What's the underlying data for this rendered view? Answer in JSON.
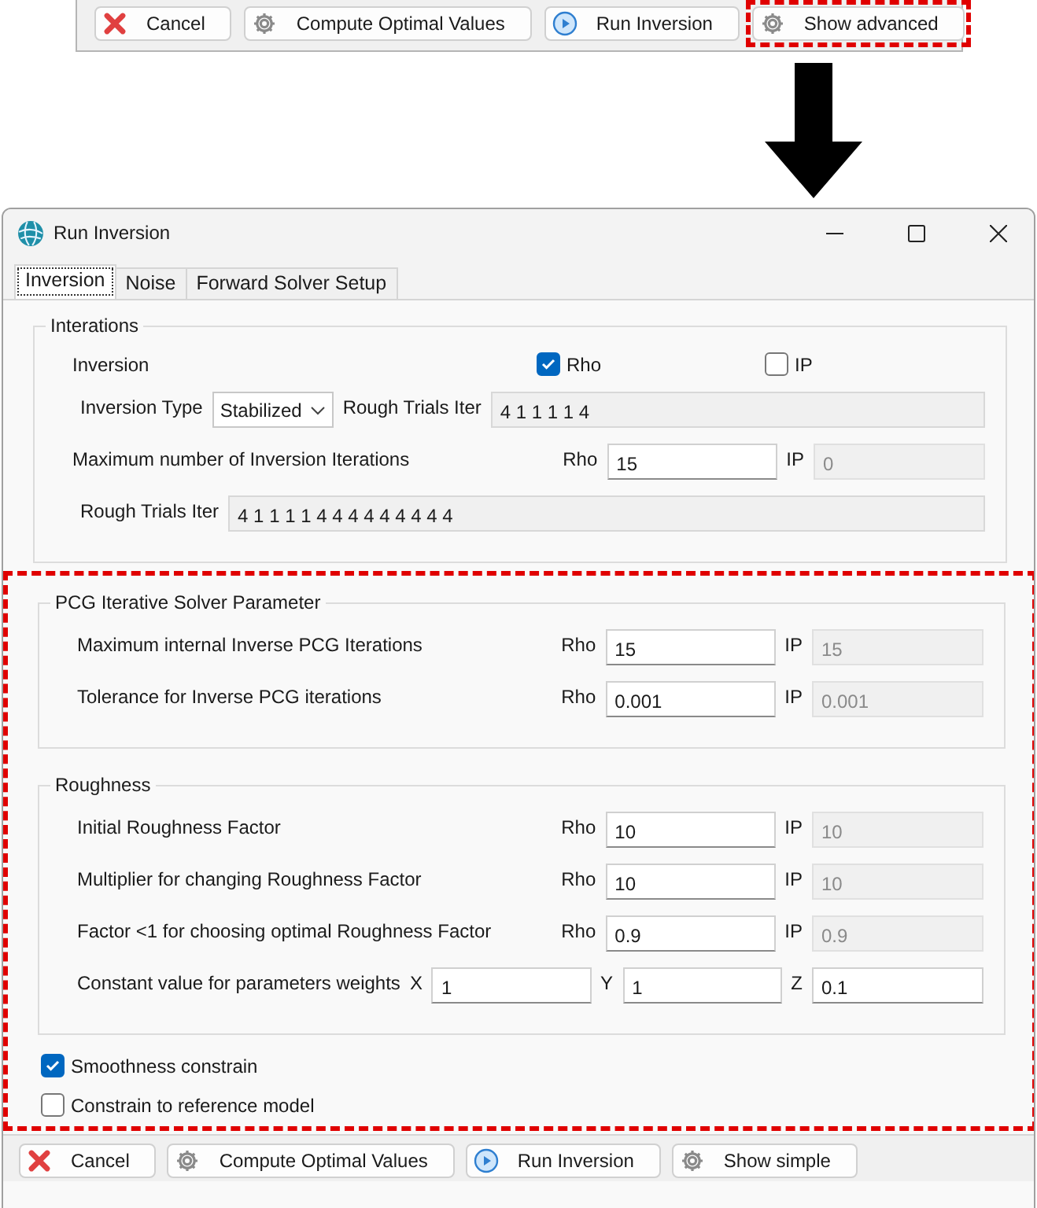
{
  "top_toolbar": {
    "buttons": [
      {
        "label": "Cancel",
        "highlighted": false
      },
      {
        "label": "Compute Optimal Values",
        "highlighted": false
      },
      {
        "label": "Run Inversion",
        "highlighted": false
      },
      {
        "label": "Show advanced",
        "highlighted": true
      }
    ]
  },
  "window": {
    "title": "Run Inversion"
  },
  "tabs": [
    {
      "label": "Inversion",
      "selected": true
    },
    {
      "label": "Noise",
      "selected": false
    },
    {
      "label": "Forward Solver Setup",
      "selected": false
    }
  ],
  "interations": {
    "title": "Interations",
    "inversion_label": "Inversion",
    "checkboxes": [
      {
        "label": "Rho",
        "checked": true
      },
      {
        "label": "IP",
        "checked": false
      }
    ],
    "inversion_type": {
      "label": "Inversion Type",
      "value": "Stabilized"
    },
    "rough_trials_short": {
      "label": "Rough Trials Iter",
      "value": "4 1 1 1 1 4",
      "readonly": true
    },
    "max_iterations": {
      "label": "Maximum number of Inversion Iterations",
      "fields": [
        {
          "label": "Rho",
          "value": "15",
          "disabled": false
        },
        {
          "label": "IP",
          "value": "0",
          "disabled": true
        }
      ]
    },
    "rough_trials": {
      "label": "Rough Trials Iter",
      "value": "4 1 1 1 1 4 4 4 4 4 4 4 4 4",
      "readonly": true
    }
  },
  "advanced": {
    "highlighted": true,
    "groups": [
      {
        "title": "PCG Iterative Solver Parameter",
        "rows": [
          {
            "kind": "pair",
            "label": "Maximum internal Inverse PCG Iterations",
            "fields": [
              {
                "label": "Rho",
                "value": "15",
                "disabled": false
              },
              {
                "label": "IP",
                "value": "15",
                "disabled": true
              }
            ]
          },
          {
            "kind": "pair",
            "label": "Tolerance for Inverse PCG iterations",
            "fields": [
              {
                "label": "Rho",
                "value": "0.001",
                "disabled": false
              },
              {
                "label": "IP",
                "value": "0.001",
                "disabled": true
              }
            ]
          }
        ]
      },
      {
        "title": "Roughness",
        "rows": [
          {
            "kind": "pair",
            "label": "Initial Roughness Factor",
            "fields": [
              {
                "label": "Rho",
                "value": "10",
                "disabled": false
              },
              {
                "label": "IP",
                "value": "10",
                "disabled": true
              }
            ]
          },
          {
            "kind": "pair",
            "label": "Multiplier for changing Roughness Factor",
            "fields": [
              {
                "label": "Rho",
                "value": "10",
                "disabled": false
              },
              {
                "label": "IP",
                "value": "10",
                "disabled": true
              }
            ]
          },
          {
            "kind": "pair",
            "label": "Factor <1 for choosing optimal Roughness Factor",
            "fields": [
              {
                "label": "Rho",
                "value": "0.9",
                "disabled": false
              },
              {
                "label": "IP",
                "value": "0.9",
                "disabled": true
              }
            ]
          },
          {
            "kind": "triple",
            "label": "Constant value for parameters weights",
            "fields": [
              {
                "label": "X",
                "value": "1",
                "disabled": false
              },
              {
                "label": "Y",
                "value": "1",
                "disabled": false
              },
              {
                "label": "Z",
                "value": "0.1",
                "disabled": false
              }
            ]
          }
        ]
      }
    ],
    "checkboxes": [
      {
        "label": "Smoothness constrain",
        "checked": true
      },
      {
        "label": "Constrain to reference model",
        "checked": false
      }
    ]
  },
  "bottom_buttons": [
    {
      "label": "Cancel",
      "highlighted": false
    },
    {
      "label": "Compute Optimal Values",
      "highlighted": false
    },
    {
      "label": "Run Inversion",
      "highlighted": false
    },
    {
      "label": "Show simple",
      "highlighted": false
    }
  ]
}
